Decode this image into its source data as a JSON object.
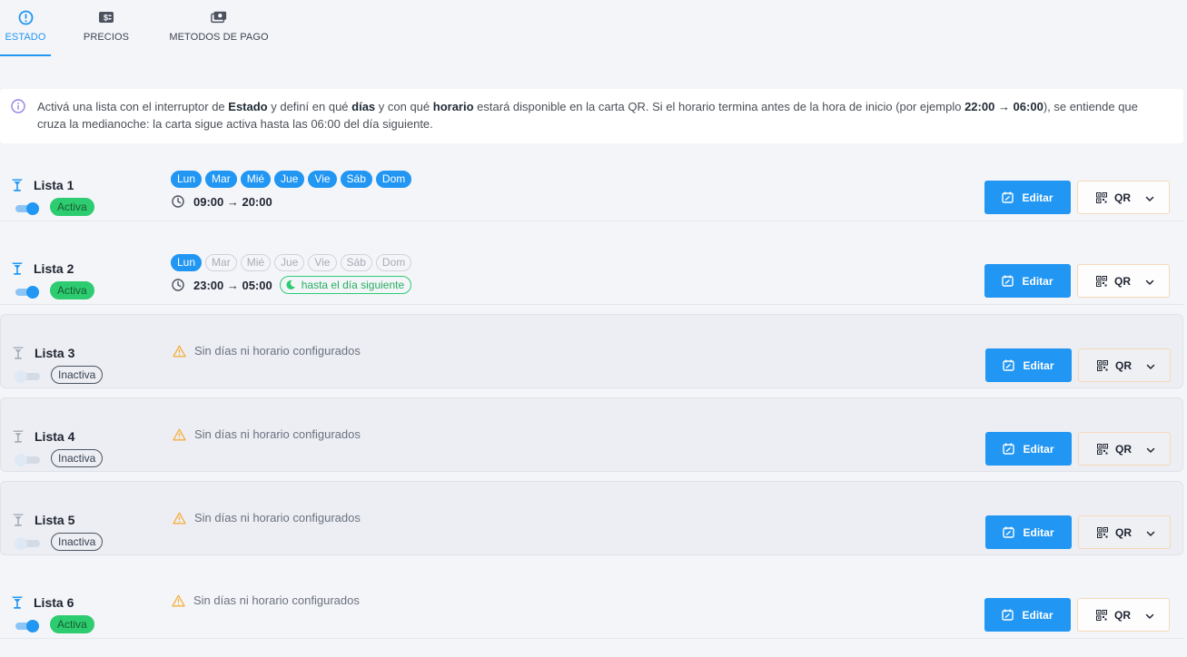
{
  "tabs": [
    {
      "label": "ESTADO",
      "icon": "alert-circle-icon",
      "active": true
    },
    {
      "label": "PRECIOS",
      "icon": "price-tag-icon",
      "active": false
    },
    {
      "label": "METODOS DE PAGO",
      "icon": "money-icon",
      "active": false
    }
  ],
  "info": {
    "t1": "Activá una lista con el interruptor de ",
    "b1": "Estado",
    "t2": " y definí en qué ",
    "b2": "días",
    "t3": " y con qué ",
    "b3": "horario",
    "t4": " estará disponible en la carta QR. Si el horario termina antes de la hora de inicio (por ejemplo ",
    "b4": "22:00 → 06:00",
    "t5": "), se entiende que cruza la medianoche: la carta sigue activa hasta las 06:00 del día siguiente."
  },
  "buttons": {
    "edit": "Editar",
    "qr": "QR"
  },
  "status": {
    "active": "Activa",
    "inactive": "Inactiva"
  },
  "empty_schedule": "Sin días ni horario configurados",
  "lists": [
    {
      "name": "Lista 1",
      "status": "Activa",
      "days": [
        {
          "label": "Lun",
          "on": true
        },
        {
          "label": "Mar",
          "on": true
        },
        {
          "label": "Mié",
          "on": true
        },
        {
          "label": "Jue",
          "on": true
        },
        {
          "label": "Vie",
          "on": true
        },
        {
          "label": "Sáb",
          "on": true
        },
        {
          "label": "Dom",
          "on": true
        }
      ],
      "time": "09:00 → 20:00",
      "next_day": ""
    },
    {
      "name": "Lista 2",
      "status": "Activa",
      "days": [
        {
          "label": "Lun",
          "on": true
        },
        {
          "label": "Mar",
          "on": false
        },
        {
          "label": "Mié",
          "on": false
        },
        {
          "label": "Jue",
          "on": false
        },
        {
          "label": "Vie",
          "on": false
        },
        {
          "label": "Sáb",
          "on": false
        },
        {
          "label": "Dom",
          "on": false
        }
      ],
      "time": "23:00 → 05:00",
      "next_day": "hasta el día siguiente"
    },
    {
      "name": "Lista 3",
      "status": "Inactiva",
      "days": [],
      "time": "",
      "next_day": ""
    },
    {
      "name": "Lista 4",
      "status": "Inactiva",
      "days": [],
      "time": "",
      "next_day": ""
    },
    {
      "name": "Lista 5",
      "status": "Inactiva",
      "days": [],
      "time": "",
      "next_day": ""
    },
    {
      "name": "Lista 6",
      "status": "Activa",
      "days": [],
      "time": "",
      "next_day": ""
    }
  ],
  "colors": {
    "accent": "#2196f3",
    "success": "#2ecc71",
    "warning": "#f5b041"
  }
}
